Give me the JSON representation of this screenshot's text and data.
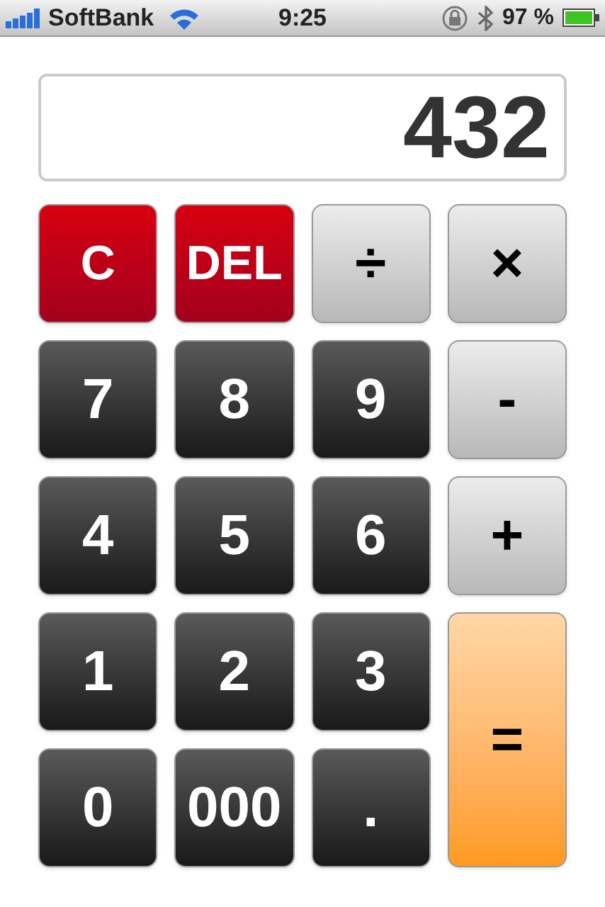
{
  "status_bar": {
    "carrier": "SoftBank",
    "time": "9:25",
    "battery": "97 %"
  },
  "display": {
    "value": "432"
  },
  "keys": [
    {
      "label": "C",
      "kind": "clear"
    },
    {
      "label": "DEL",
      "kind": "clear"
    },
    {
      "label": "÷",
      "kind": "operator"
    },
    {
      "label": "×",
      "kind": "operator"
    },
    {
      "label": "7",
      "kind": "digit"
    },
    {
      "label": "8",
      "kind": "digit"
    },
    {
      "label": "9",
      "kind": "digit"
    },
    {
      "label": "-",
      "kind": "operator"
    },
    {
      "label": "4",
      "kind": "digit"
    },
    {
      "label": "5",
      "kind": "digit"
    },
    {
      "label": "6",
      "kind": "digit"
    },
    {
      "label": "+",
      "kind": "operator"
    },
    {
      "label": "1",
      "kind": "digit"
    },
    {
      "label": "2",
      "kind": "digit"
    },
    {
      "label": "3",
      "kind": "digit"
    },
    {
      "label": "=",
      "kind": "equals"
    },
    {
      "label": "0",
      "kind": "digit"
    },
    {
      "label": "000",
      "kind": "digit"
    },
    {
      "label": ".",
      "kind": "digit"
    }
  ]
}
